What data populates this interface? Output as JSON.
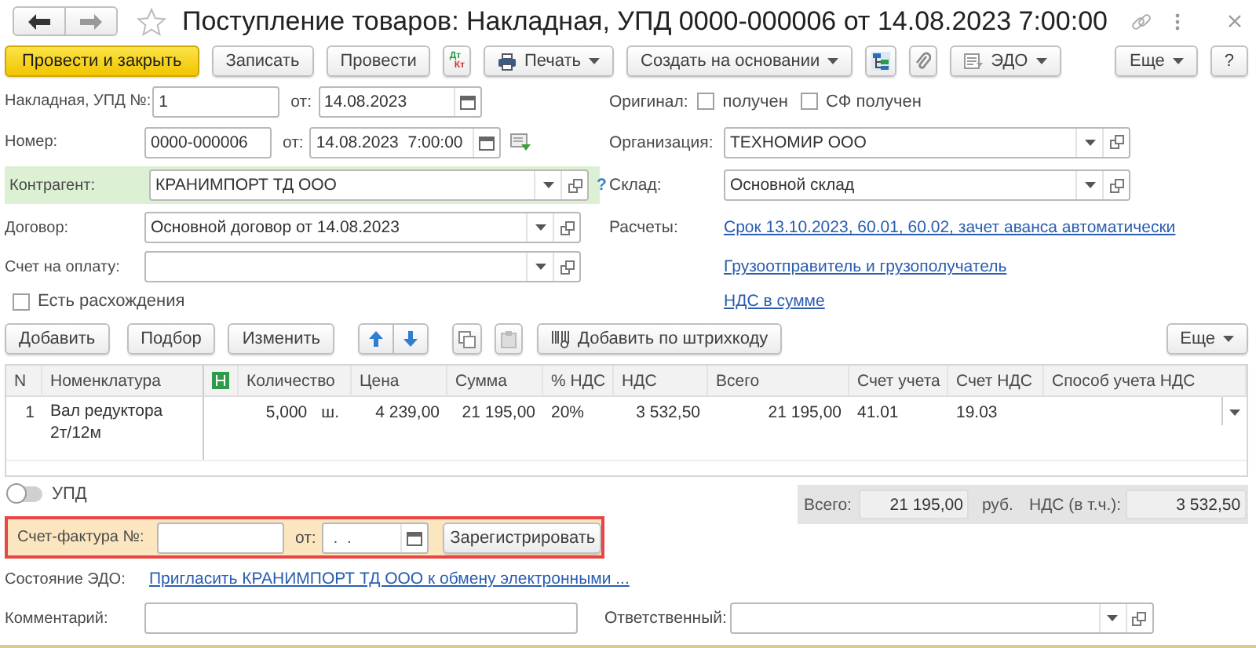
{
  "window": {
    "title": "Поступление товаров: Накладная, УПД 0000-000006 от 14.08.2023 7:00:00"
  },
  "toolbar": {
    "left": [
      {
        "kind": "primary",
        "label": "Провести и закрыть"
      },
      {
        "kind": "button",
        "label": "Записать"
      },
      {
        "kind": "button",
        "label": "Провести"
      },
      {
        "kind": "dtkt",
        "labels": [
          "Дт",
          "Кт"
        ]
      },
      {
        "kind": "print",
        "label": "Печать"
      },
      {
        "kind": "menu",
        "label": "Создать на основании"
      },
      {
        "kind": "structure"
      },
      {
        "kind": "clip"
      },
      {
        "kind": "edo",
        "label": "ЭДО"
      }
    ],
    "right": [
      {
        "kind": "menu",
        "label": "Еще"
      },
      {
        "kind": "button",
        "label": "?"
      }
    ]
  },
  "invoice": {
    "label": "Накладная, УПД №:",
    "number": "1",
    "date_label": "от:",
    "date": "14.08.2023"
  },
  "number": {
    "label": "Номер:",
    "value": "0000-000006",
    "date_label": "от:",
    "date": "14.08.2023  7:00:00"
  },
  "left_fields": [
    {
      "label": "Контрагент:",
      "value": "КРАНИМПОРТ ТД ООО",
      "highlighted": true,
      "help": "?"
    },
    {
      "label": "Договор:",
      "value": "Основной договор от 14.08.2023",
      "highlighted": false
    },
    {
      "label": "Счет на оплату:",
      "highlighted": false
    }
  ],
  "discrepancy": {
    "label": "Есть расхождения",
    "checked": false
  },
  "original": {
    "label": "Оригинал:",
    "options": [
      {
        "label": "получен",
        "checked": false
      },
      {
        "label": "СФ получен",
        "checked": false
      }
    ]
  },
  "right_fields": [
    {
      "label": "Организация:",
      "value": "ТЕХНОМИР ООО"
    },
    {
      "label": "Склад:",
      "value": "Основной склад"
    }
  ],
  "settlements": {
    "label": "Расчеты:",
    "links": [
      "Срок 13.10.2023, 60.01, 60.02, зачет аванса автоматически",
      "Грузоотправитель и грузополучатель",
      "НДС в сумме"
    ]
  },
  "table_toolbar": {
    "left": [
      {
        "kind": "button",
        "label": "Добавить"
      },
      {
        "kind": "button",
        "label": "Подбор"
      },
      {
        "kind": "button",
        "label": "Изменить"
      },
      {
        "kind": "updown"
      },
      {
        "kind": "copy"
      },
      {
        "kind": "paste"
      },
      {
        "kind": "barcode",
        "label": "Добавить по штрихкоду"
      }
    ],
    "right": [
      {
        "kind": "menu",
        "label": "Еще"
      }
    ]
  },
  "table": {
    "columns": [
      {
        "label": "N"
      },
      {
        "label": "Номенклатура"
      },
      {
        "kind": "icon"
      },
      {
        "label": "Количество"
      },
      {
        "label": "Цена"
      },
      {
        "label": "Сумма"
      },
      {
        "label": "% НДС"
      },
      {
        "label": "НДС"
      },
      {
        "label": "Всего"
      },
      {
        "label": "Счет учета"
      },
      {
        "label": "Счет НДС"
      },
      {
        "label": "Способ учета НДС"
      }
    ],
    "rows": [
      {
        "n": "1",
        "item": "Вал редуктора 2т/12м",
        "quantity": "5,000",
        "unit": "ш.",
        "price": "4 239,00",
        "amount": "21 195,00",
        "vat_rate": "20%",
        "vat": "3 532,50",
        "total": "21 195,00",
        "account": "41.01",
        "vat_account": "19.03"
      }
    ]
  },
  "upd_toggle": {
    "label": "УПД",
    "on": false
  },
  "totals": [
    {
      "label": "Всего:",
      "value": "21 195,00",
      "unit": "руб."
    },
    {
      "label": "НДС (в т.ч.):",
      "value": "3 532,50"
    }
  ],
  "invoice_register": {
    "label": "Счет-фактура №:",
    "date_label": "от:",
    "date_placeholder": " .  .",
    "button": "Зарегистрировать"
  },
  "edo_state": {
    "label": "Состояние ЭДО:",
    "link": "Пригласить КРАНИМПОРТ ТД ООО к обмену электронными ..."
  },
  "comment": {
    "label": "Комментарий:"
  },
  "responsible": {
    "label": "Ответственный:"
  }
}
